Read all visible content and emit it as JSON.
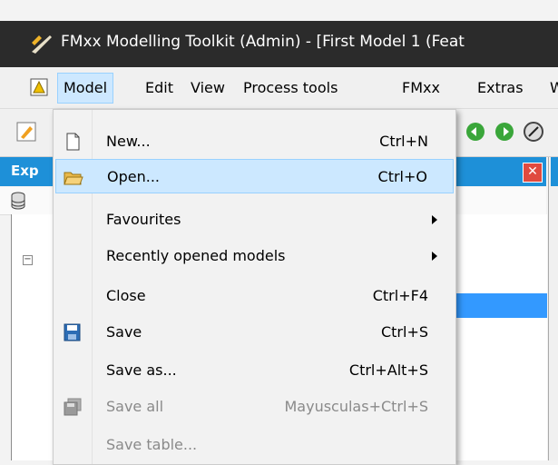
{
  "window": {
    "title": "FMxx Modelling Toolkit (Admin) - [First Model 1 (Feat"
  },
  "menubar": {
    "items": [
      {
        "label": "Model",
        "active": true
      },
      {
        "label": "Edit"
      },
      {
        "label": "View"
      },
      {
        "label": "Process tools"
      },
      {
        "label": "FMxx"
      },
      {
        "label": "Extras"
      },
      {
        "label": "W"
      }
    ]
  },
  "explorer": {
    "title": "Exp",
    "close_icon": "close-icon"
  },
  "model_menu": {
    "items": [
      {
        "label": "New...",
        "shortcut": "Ctrl+N",
        "icon": "new-document-icon"
      },
      {
        "label": "Open...",
        "shortcut": "Ctrl+O",
        "icon": "open-folder-icon",
        "highlighted": true
      },
      {
        "label": "Favourites",
        "submenu": true
      },
      {
        "label": "Recently opened models",
        "submenu": true
      },
      {
        "label": "Close",
        "shortcut": "Ctrl+F4"
      },
      {
        "label": "Save",
        "shortcut": "Ctrl+S",
        "icon": "save-disk-icon"
      },
      {
        "label": "Save as...",
        "shortcut": "Ctrl+Alt+S"
      },
      {
        "label": "Save all",
        "shortcut": "Mayusculas+Ctrl+S",
        "icon": "save-all-icon",
        "disabled": true
      },
      {
        "label": "Save table...",
        "disabled": true
      }
    ]
  },
  "colors": {
    "titlebar": "#2b2b2b",
    "accent": "#1e90d8",
    "highlight": "#cce8ff",
    "highlight_border": "#99d1ff"
  }
}
